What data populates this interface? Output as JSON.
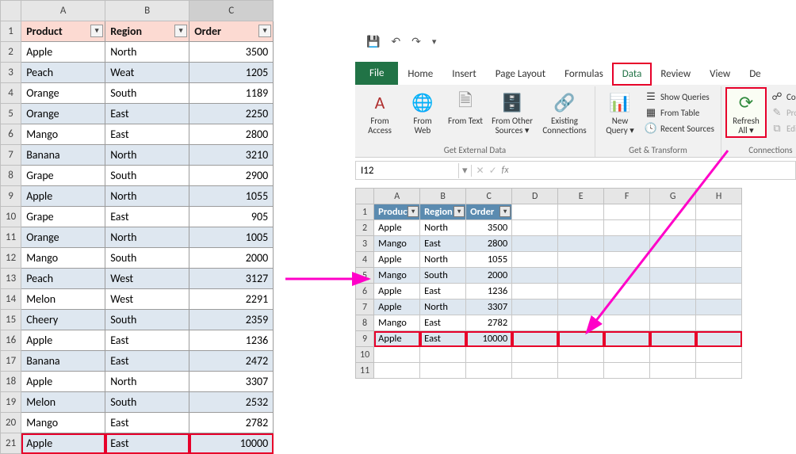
{
  "left": {
    "cols": [
      "A",
      "B",
      "C"
    ],
    "headers": {
      "product": "Product",
      "region": "Region",
      "order": "Order"
    },
    "rows": [
      {
        "p": "Apple",
        "r": "North",
        "o": 3500
      },
      {
        "p": "Peach",
        "r": "Weat",
        "o": 1205
      },
      {
        "p": "Orange",
        "r": "South",
        "o": 1189
      },
      {
        "p": "Orange",
        "r": "East",
        "o": 2250
      },
      {
        "p": "Mango",
        "r": "East",
        "o": 2800
      },
      {
        "p": "Banana",
        "r": "North",
        "o": 3210
      },
      {
        "p": "Grape",
        "r": "South",
        "o": 2900
      },
      {
        "p": "Apple",
        "r": "North",
        "o": 1055
      },
      {
        "p": "Grape",
        "r": "East",
        "o": 905
      },
      {
        "p": "Orange",
        "r": "North",
        "o": 1005
      },
      {
        "p": "Mango",
        "r": "South",
        "o": 2000
      },
      {
        "p": "Peach",
        "r": "West",
        "o": 3127
      },
      {
        "p": "Melon",
        "r": "West",
        "o": 2291
      },
      {
        "p": "Cheery",
        "r": "South",
        "o": 2359
      },
      {
        "p": "Apple",
        "r": "East",
        "o": 1236
      },
      {
        "p": "Banana",
        "r": "East",
        "o": 2472
      },
      {
        "p": "Apple",
        "r": "North",
        "o": 3307
      },
      {
        "p": "Melon",
        "r": "South",
        "o": 2532
      },
      {
        "p": "Mango",
        "r": "East",
        "o": 2782
      },
      {
        "p": "Apple",
        "r": "East",
        "o": 10000
      }
    ]
  },
  "right": {
    "namebox": "I12",
    "tabs": {
      "file": "File",
      "home": "Home",
      "insert": "Insert",
      "pagelayout": "Page Layout",
      "formulas": "Formulas",
      "data": "Data",
      "review": "Review",
      "view": "View",
      "dev": "De"
    },
    "ribbon": {
      "ext": {
        "label": "Get External Data",
        "access": "From Access",
        "web": "From Web",
        "text": "From Text",
        "other": "From Other Sources ▾",
        "existing": "Existing Connections"
      },
      "gt": {
        "label": "Get & Transform",
        "newq": "New Query ▾",
        "showq": "Show Queries",
        "fromtable": "From Table",
        "recent": "Recent Sources"
      },
      "conn": {
        "label": "Connections",
        "refresh": "Refresh All ▾",
        "connec": "Connec",
        "propert": "Propert",
        "edit": "Edit Lin"
      }
    },
    "cols": [
      "A",
      "B",
      "C",
      "D",
      "E",
      "F",
      "G",
      "H"
    ],
    "headers": {
      "product": "Product",
      "region": "Region",
      "order": "Order"
    },
    "rows": [
      {
        "p": "Apple",
        "r": "North",
        "o": 3500
      },
      {
        "p": "Mango",
        "r": "East",
        "o": 2800
      },
      {
        "p": "Apple",
        "r": "North",
        "o": 1055
      },
      {
        "p": "Mango",
        "r": "South",
        "o": 2000
      },
      {
        "p": "Apple",
        "r": "East",
        "o": 1236
      },
      {
        "p": "Apple",
        "r": "North",
        "o": 3307
      },
      {
        "p": "Mango",
        "r": "East",
        "o": 2782
      },
      {
        "p": "Apple",
        "r": "East",
        "o": 10000
      }
    ]
  }
}
